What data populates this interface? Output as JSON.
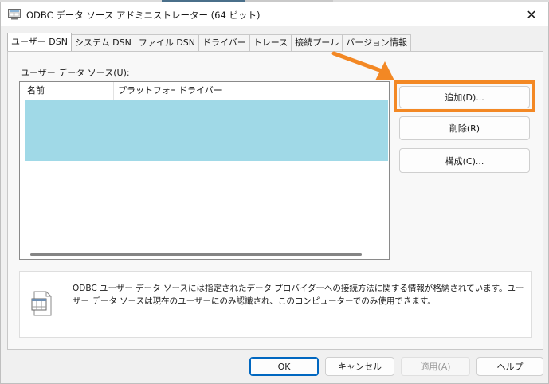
{
  "window": {
    "title": "ODBC データ ソース アドミニストレーター (64 ビット)",
    "close_glyph": "✕"
  },
  "tabs": [
    {
      "label": "ユーザー DSN",
      "active": true
    },
    {
      "label": "システム DSN",
      "active": false
    },
    {
      "label": "ファイル DSN",
      "active": false
    },
    {
      "label": "ドライバー",
      "active": false
    },
    {
      "label": "トレース",
      "active": false
    },
    {
      "label": "接続プール",
      "active": false
    },
    {
      "label": "バージョン情報",
      "active": false
    }
  ],
  "user_dsn": {
    "list_label": "ユーザー データ ソース(U):",
    "columns": [
      "名前",
      "プラットフォーム",
      "ドライバー"
    ],
    "buttons": {
      "add": "追加(D)...",
      "remove": "削除(R)",
      "configure": "構成(C)..."
    },
    "info_text": "ODBC ユーザー データ ソースには指定されたデータ プロバイダーへの接続方法に関する情報が格納されています。ユーザー データ ソースは現在のユーザーにのみ認識され、このコンピューターでのみ使用できます。"
  },
  "footer": {
    "ok": "OK",
    "cancel": "キャンセル",
    "apply": "適用(A)",
    "help": "ヘルプ"
  },
  "colors": {
    "accent_highlight": "#f38824",
    "selection_row": "#a0d9e7",
    "primary_border": "#0067c0"
  },
  "icons": {
    "app": "odbc-app-icon",
    "info": "data-table-icon",
    "annotation": "orange-arrow"
  }
}
